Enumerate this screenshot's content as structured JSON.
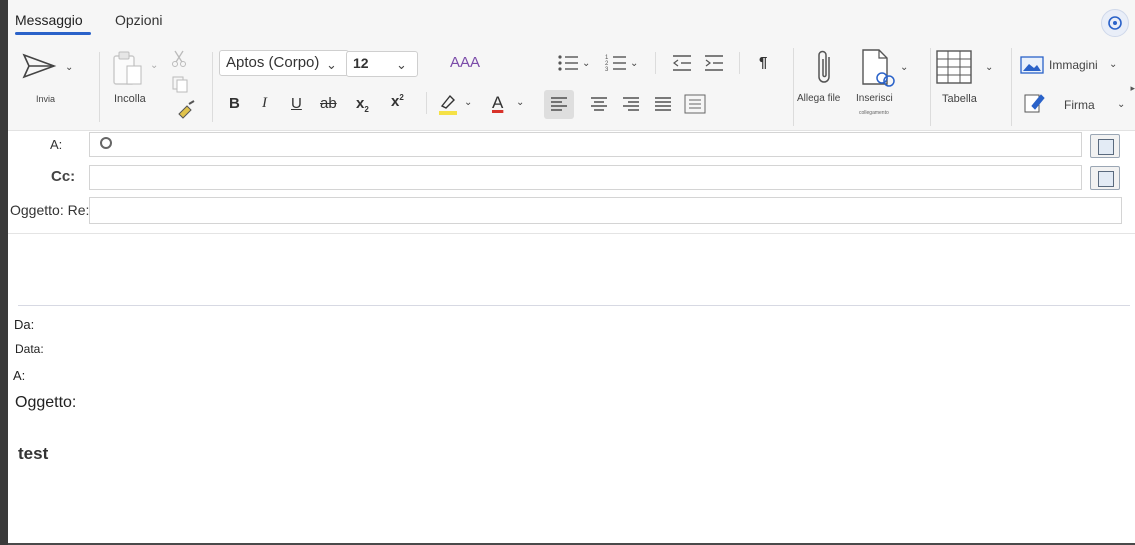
{
  "tabs": [
    {
      "label": "Messaggio",
      "active": true
    },
    {
      "label": "Opzioni",
      "active": false
    }
  ],
  "ribbon": {
    "send_label": "Invia",
    "paste_label": "Incolla",
    "font_family": "Aptos (Corpo)",
    "font_size": "12",
    "text_effects_label": "AAA",
    "bold": "B",
    "italic": "I",
    "underline": "U",
    "strikethrough": "ab",
    "subscript": "x",
    "subscript_mark": "2",
    "superscript": "x",
    "superscript_mark": "2",
    "font_color": "A",
    "paragraph_mark": "¶",
    "attach_label": "Allega file",
    "insert_label": "Inserisci",
    "insert_sub_label": "collegamento",
    "table_label": "Tabella",
    "images_label": "Immagini",
    "signature_label": "Firma"
  },
  "fields": {
    "to_label": "A:",
    "cc_label": "Cc:",
    "subject_label": "Oggetto: Re:"
  },
  "quoted": {
    "from_label": "Da:",
    "date_label": "Data:",
    "to_label": "A:",
    "subject_label": "Oggetto:"
  },
  "body": {
    "text": "test"
  },
  "colors": {
    "accent": "#2a62c9",
    "highlight": "#f5e146",
    "font_color_bar": "#d8322a",
    "text_effects": "#7a4aa8"
  },
  "icons": {
    "send": "paper-plane",
    "paste": "clipboard",
    "cut": "scissors",
    "copy": "copy",
    "format_painter": "brush",
    "bullets": "bullet-list",
    "numbering": "numbered-list",
    "outdent": "decrease-indent",
    "indent": "increase-indent",
    "attach": "paperclip",
    "link": "document-link",
    "table": "table-grid",
    "images": "picture",
    "signature": "signature-pen",
    "address_book": "address-book"
  }
}
